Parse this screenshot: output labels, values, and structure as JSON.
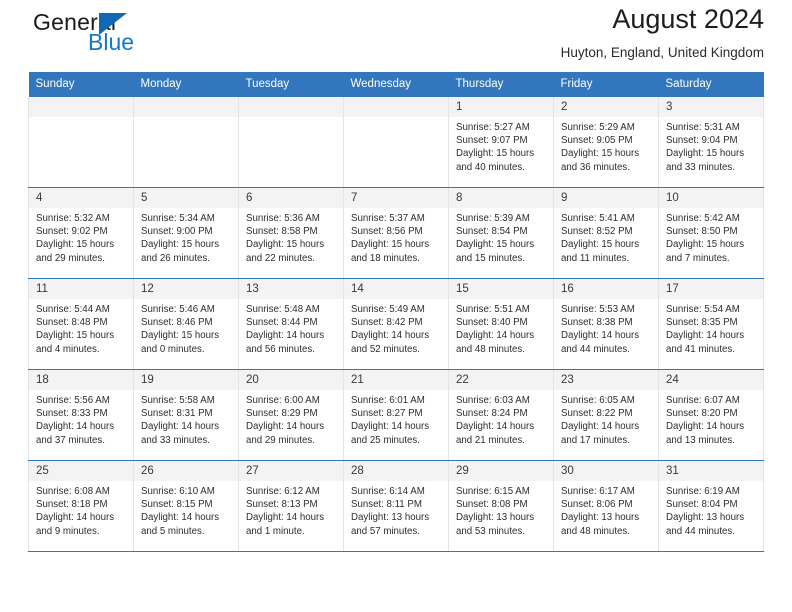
{
  "brand": {
    "name_top": "General",
    "name_bottom": "Blue",
    "accent_color": "#1579c6",
    "triangle_color": "#1268b3"
  },
  "header": {
    "title": "August 2024",
    "subtitle": "Huyton, England, United Kingdom"
  },
  "calendar": {
    "header_bg": "#3277bd",
    "header_text_color": "#ffffff",
    "daynum_bg": "#f3f3f3",
    "weekday_headers": [
      "Sunday",
      "Monday",
      "Tuesday",
      "Wednesday",
      "Thursday",
      "Friday",
      "Saturday"
    ],
    "weeks": [
      [
        {
          "day": ""
        },
        {
          "day": ""
        },
        {
          "day": ""
        },
        {
          "day": ""
        },
        {
          "day": "1",
          "sunrise": "Sunrise: 5:27 AM",
          "sunset": "Sunset: 9:07 PM",
          "daylight_1": "Daylight: 15 hours",
          "daylight_2": "and 40 minutes."
        },
        {
          "day": "2",
          "sunrise": "Sunrise: 5:29 AM",
          "sunset": "Sunset: 9:05 PM",
          "daylight_1": "Daylight: 15 hours",
          "daylight_2": "and 36 minutes."
        },
        {
          "day": "3",
          "sunrise": "Sunrise: 5:31 AM",
          "sunset": "Sunset: 9:04 PM",
          "daylight_1": "Daylight: 15 hours",
          "daylight_2": "and 33 minutes."
        }
      ],
      [
        {
          "day": "4",
          "sunrise": "Sunrise: 5:32 AM",
          "sunset": "Sunset: 9:02 PM",
          "daylight_1": "Daylight: 15 hours",
          "daylight_2": "and 29 minutes."
        },
        {
          "day": "5",
          "sunrise": "Sunrise: 5:34 AM",
          "sunset": "Sunset: 9:00 PM",
          "daylight_1": "Daylight: 15 hours",
          "daylight_2": "and 26 minutes."
        },
        {
          "day": "6",
          "sunrise": "Sunrise: 5:36 AM",
          "sunset": "Sunset: 8:58 PM",
          "daylight_1": "Daylight: 15 hours",
          "daylight_2": "and 22 minutes."
        },
        {
          "day": "7",
          "sunrise": "Sunrise: 5:37 AM",
          "sunset": "Sunset: 8:56 PM",
          "daylight_1": "Daylight: 15 hours",
          "daylight_2": "and 18 minutes."
        },
        {
          "day": "8",
          "sunrise": "Sunrise: 5:39 AM",
          "sunset": "Sunset: 8:54 PM",
          "daylight_1": "Daylight: 15 hours",
          "daylight_2": "and 15 minutes."
        },
        {
          "day": "9",
          "sunrise": "Sunrise: 5:41 AM",
          "sunset": "Sunset: 8:52 PM",
          "daylight_1": "Daylight: 15 hours",
          "daylight_2": "and 11 minutes."
        },
        {
          "day": "10",
          "sunrise": "Sunrise: 5:42 AM",
          "sunset": "Sunset: 8:50 PM",
          "daylight_1": "Daylight: 15 hours",
          "daylight_2": "and 7 minutes."
        }
      ],
      [
        {
          "day": "11",
          "sunrise": "Sunrise: 5:44 AM",
          "sunset": "Sunset: 8:48 PM",
          "daylight_1": "Daylight: 15 hours",
          "daylight_2": "and 4 minutes."
        },
        {
          "day": "12",
          "sunrise": "Sunrise: 5:46 AM",
          "sunset": "Sunset: 8:46 PM",
          "daylight_1": "Daylight: 15 hours",
          "daylight_2": "and 0 minutes."
        },
        {
          "day": "13",
          "sunrise": "Sunrise: 5:48 AM",
          "sunset": "Sunset: 8:44 PM",
          "daylight_1": "Daylight: 14 hours",
          "daylight_2": "and 56 minutes."
        },
        {
          "day": "14",
          "sunrise": "Sunrise: 5:49 AM",
          "sunset": "Sunset: 8:42 PM",
          "daylight_1": "Daylight: 14 hours",
          "daylight_2": "and 52 minutes."
        },
        {
          "day": "15",
          "sunrise": "Sunrise: 5:51 AM",
          "sunset": "Sunset: 8:40 PM",
          "daylight_1": "Daylight: 14 hours",
          "daylight_2": "and 48 minutes."
        },
        {
          "day": "16",
          "sunrise": "Sunrise: 5:53 AM",
          "sunset": "Sunset: 8:38 PM",
          "daylight_1": "Daylight: 14 hours",
          "daylight_2": "and 44 minutes."
        },
        {
          "day": "17",
          "sunrise": "Sunrise: 5:54 AM",
          "sunset": "Sunset: 8:35 PM",
          "daylight_1": "Daylight: 14 hours",
          "daylight_2": "and 41 minutes."
        }
      ],
      [
        {
          "day": "18",
          "sunrise": "Sunrise: 5:56 AM",
          "sunset": "Sunset: 8:33 PM",
          "daylight_1": "Daylight: 14 hours",
          "daylight_2": "and 37 minutes."
        },
        {
          "day": "19",
          "sunrise": "Sunrise: 5:58 AM",
          "sunset": "Sunset: 8:31 PM",
          "daylight_1": "Daylight: 14 hours",
          "daylight_2": "and 33 minutes."
        },
        {
          "day": "20",
          "sunrise": "Sunrise: 6:00 AM",
          "sunset": "Sunset: 8:29 PM",
          "daylight_1": "Daylight: 14 hours",
          "daylight_2": "and 29 minutes."
        },
        {
          "day": "21",
          "sunrise": "Sunrise: 6:01 AM",
          "sunset": "Sunset: 8:27 PM",
          "daylight_1": "Daylight: 14 hours",
          "daylight_2": "and 25 minutes."
        },
        {
          "day": "22",
          "sunrise": "Sunrise: 6:03 AM",
          "sunset": "Sunset: 8:24 PM",
          "daylight_1": "Daylight: 14 hours",
          "daylight_2": "and 21 minutes."
        },
        {
          "day": "23",
          "sunrise": "Sunrise: 6:05 AM",
          "sunset": "Sunset: 8:22 PM",
          "daylight_1": "Daylight: 14 hours",
          "daylight_2": "and 17 minutes."
        },
        {
          "day": "24",
          "sunrise": "Sunrise: 6:07 AM",
          "sunset": "Sunset: 8:20 PM",
          "daylight_1": "Daylight: 14 hours",
          "daylight_2": "and 13 minutes."
        }
      ],
      [
        {
          "day": "25",
          "sunrise": "Sunrise: 6:08 AM",
          "sunset": "Sunset: 8:18 PM",
          "daylight_1": "Daylight: 14 hours",
          "daylight_2": "and 9 minutes."
        },
        {
          "day": "26",
          "sunrise": "Sunrise: 6:10 AM",
          "sunset": "Sunset: 8:15 PM",
          "daylight_1": "Daylight: 14 hours",
          "daylight_2": "and 5 minutes."
        },
        {
          "day": "27",
          "sunrise": "Sunrise: 6:12 AM",
          "sunset": "Sunset: 8:13 PM",
          "daylight_1": "Daylight: 14 hours",
          "daylight_2": "and 1 minute."
        },
        {
          "day": "28",
          "sunrise": "Sunrise: 6:14 AM",
          "sunset": "Sunset: 8:11 PM",
          "daylight_1": "Daylight: 13 hours",
          "daylight_2": "and 57 minutes."
        },
        {
          "day": "29",
          "sunrise": "Sunrise: 6:15 AM",
          "sunset": "Sunset: 8:08 PM",
          "daylight_1": "Daylight: 13 hours",
          "daylight_2": "and 53 minutes."
        },
        {
          "day": "30",
          "sunrise": "Sunrise: 6:17 AM",
          "sunset": "Sunset: 8:06 PM",
          "daylight_1": "Daylight: 13 hours",
          "daylight_2": "and 48 minutes."
        },
        {
          "day": "31",
          "sunrise": "Sunrise: 6:19 AM",
          "sunset": "Sunset: 8:04 PM",
          "daylight_1": "Daylight: 13 hours",
          "daylight_2": "and 44 minutes."
        }
      ]
    ]
  }
}
